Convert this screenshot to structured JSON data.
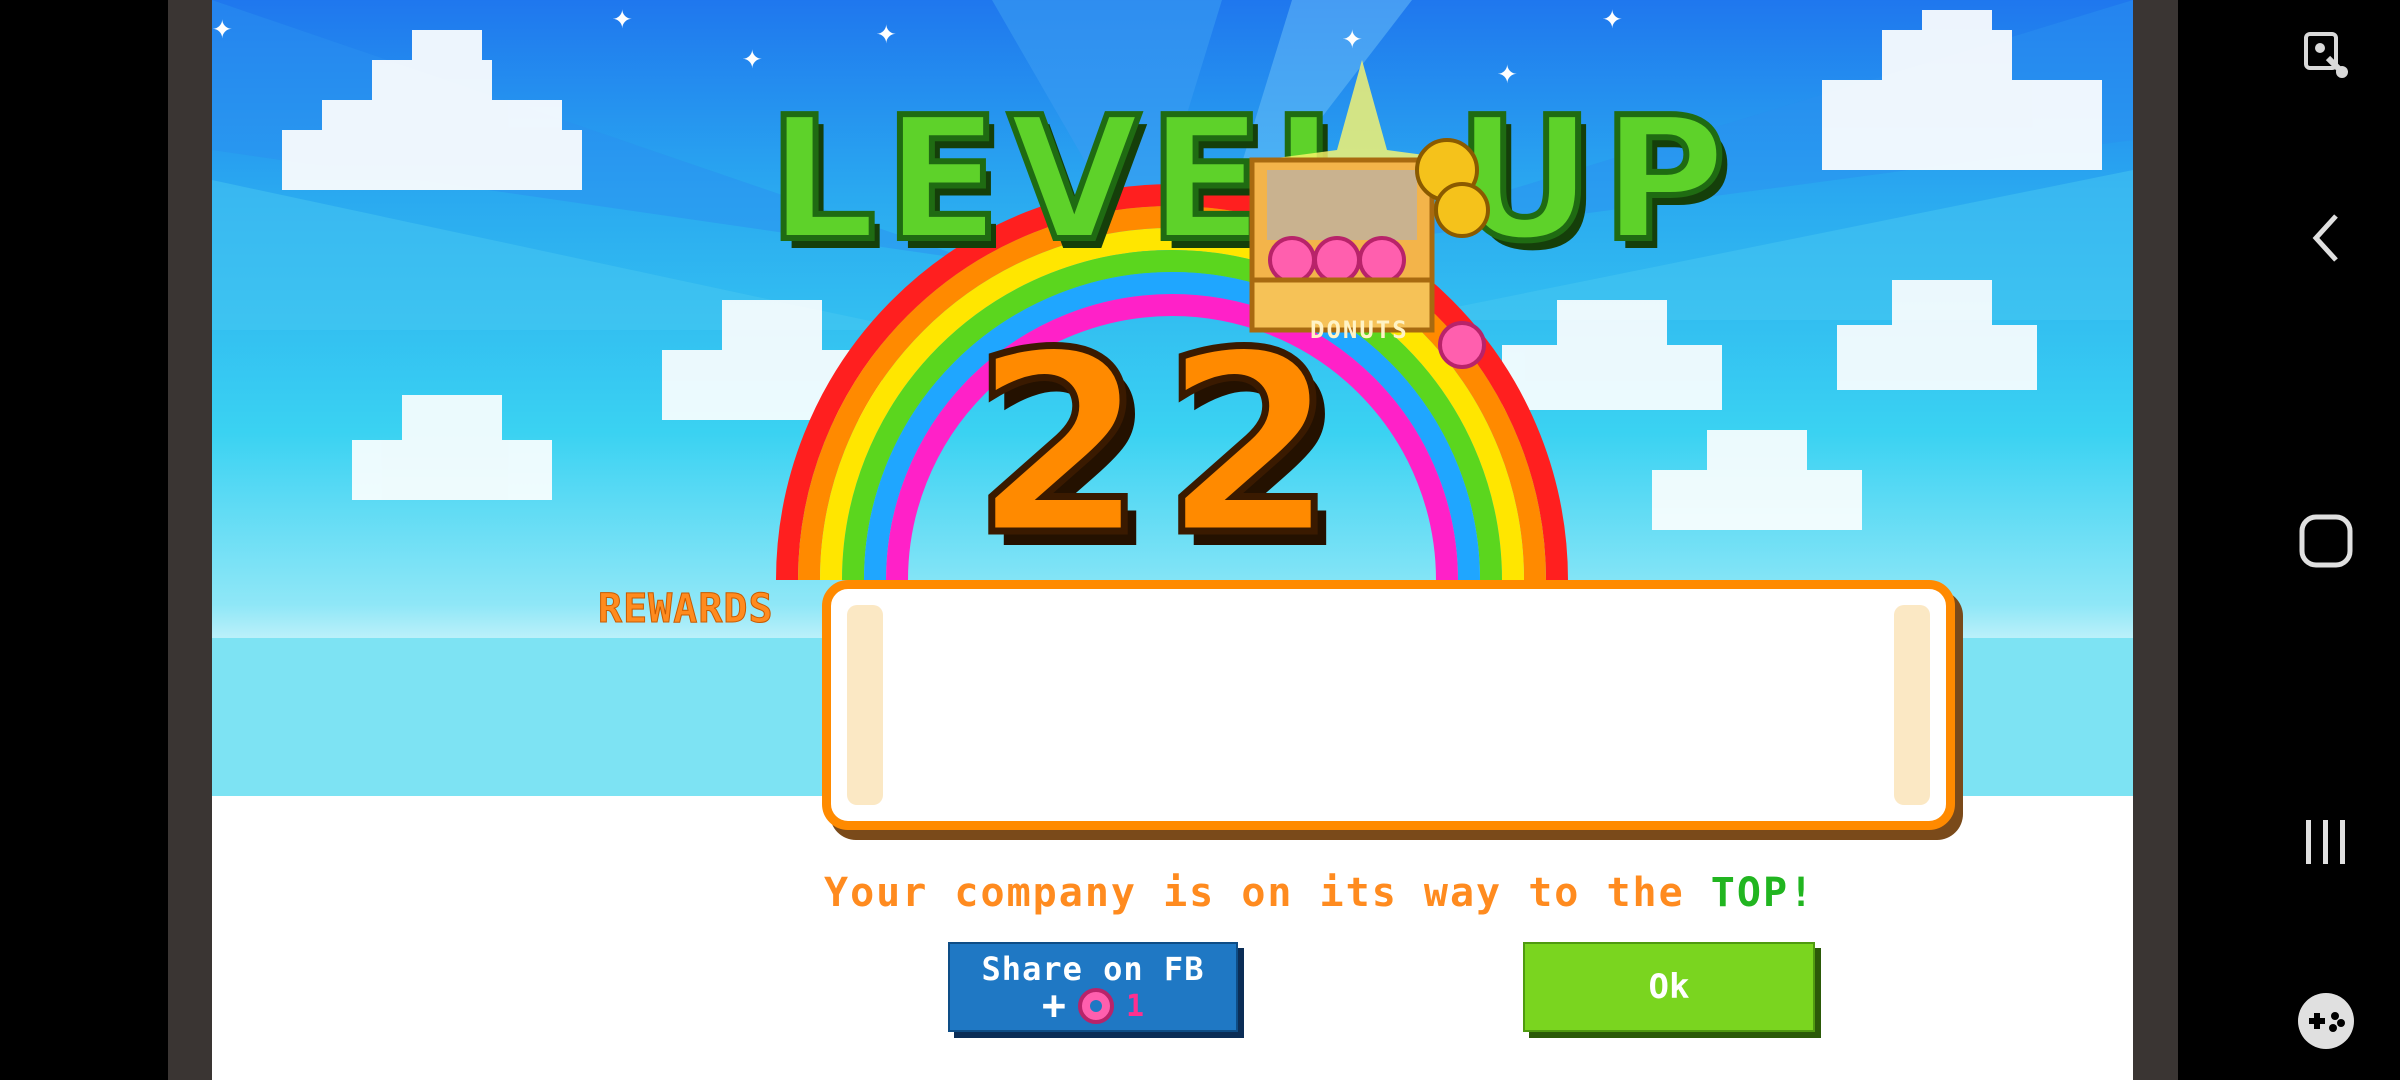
{
  "level_up": {
    "title": "LEVEL UP",
    "level_number": "22",
    "chest_label": "DONUTS"
  },
  "rewards": {
    "label": "REWARDS"
  },
  "message": {
    "prefix": "Your company is on its way to the ",
    "highlight": "TOP!"
  },
  "buttons": {
    "share_label": "Share on FB",
    "share_plus": "+",
    "share_reward": "1",
    "ok_label": "Ok"
  },
  "colors": {
    "level_green": "#5ed22a",
    "number_orange": "#ff8a00",
    "share_blue": "#1f78c4",
    "ok_green": "#7ad51f",
    "top_green": "#21b520"
  },
  "nav": {
    "icons": [
      "accessibility-icon",
      "back-icon",
      "home-icon",
      "recents-icon",
      "game-launcher-icon"
    ]
  }
}
